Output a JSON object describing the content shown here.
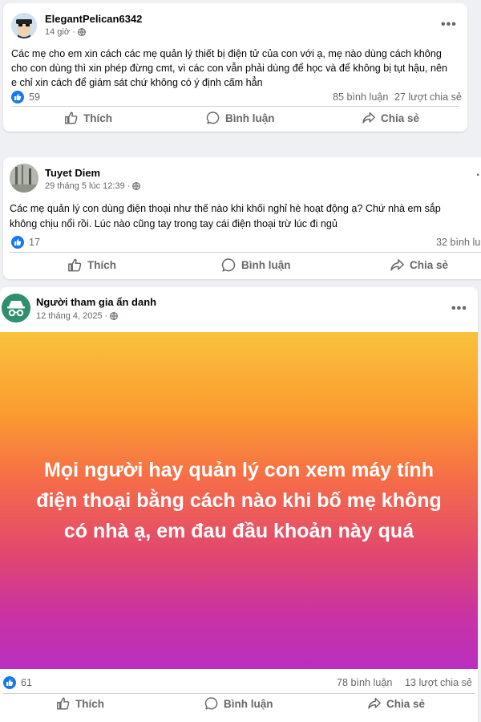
{
  "posts": [
    {
      "author": "ElegantPelican6342",
      "time": "14 giờ",
      "text_lines": [
        "Các mẹ cho em xin cách các mẹ quản lý thiết bị điện tử của con với ạ, mẹ nào dùng cách không",
        "cho con dùng thì xin phép đừng cmt, vì các con vẫn phải dùng để học và để không bị tụt hậu, nên",
        "e chỉ xin cách để giám sát chứ không có ý định cấm hẳn"
      ],
      "likes": "59",
      "comments": "85 bình luận",
      "shares": "27 lượt chia sẻ"
    },
    {
      "author": "Tuyet Diem",
      "time": "29 tháng 5 lúc 12:39",
      "text_lines": [
        "Các mẹ quản lý con dùng điện thoại như thế nào khi khối nghỉ hè hoạt động ạ? Chứ nhà em sắp",
        "không chịu nổi rồi. Lúc nào cũng tay trong tay cái điện thoại trừ lúc đi ngủ"
      ],
      "likes": "17",
      "comments": "32 bình lu"
    },
    {
      "author": "Người tham gia ẩn danh",
      "time": "12 tháng 4, 2025",
      "gradient_lines": [
        "Mọi người hay quản lý con xem máy tính",
        "điện thoại bằng cách nào khi bố mẹ không",
        "có nhà ạ, em đau đầu khoản này quá"
      ],
      "likes": "61",
      "comments": "78 bình luận",
      "shares": "13 lượt chia sẻ"
    }
  ],
  "actions": {
    "like": "Thích",
    "comment": "Bình luận",
    "share": "Chia sẻ"
  },
  "more_menu": "•••",
  "colors": {
    "accent": "#1877f2",
    "secondary_text": "#65676b",
    "gradient_top": "#f9c23c",
    "gradient_bottom": "#b92fc0"
  }
}
